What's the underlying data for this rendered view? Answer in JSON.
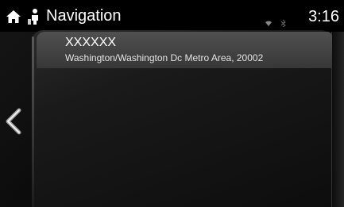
{
  "header": {
    "title": "Navigation",
    "time": "3:16",
    "icons": [
      "home-icon",
      "navigation-person-icon",
      "signal-icon",
      "bluetooth-icon"
    ]
  },
  "results": [
    {
      "name": "XXXXXX",
      "address": "Washington/Washington Dc Metro Area, 20002"
    }
  ],
  "controls": {
    "back_icon": "chevron-left-icon"
  },
  "colors": {
    "background": "#000000",
    "panel": "#1a1a1a",
    "selected_row": "#454545",
    "text": "#ffffff"
  }
}
